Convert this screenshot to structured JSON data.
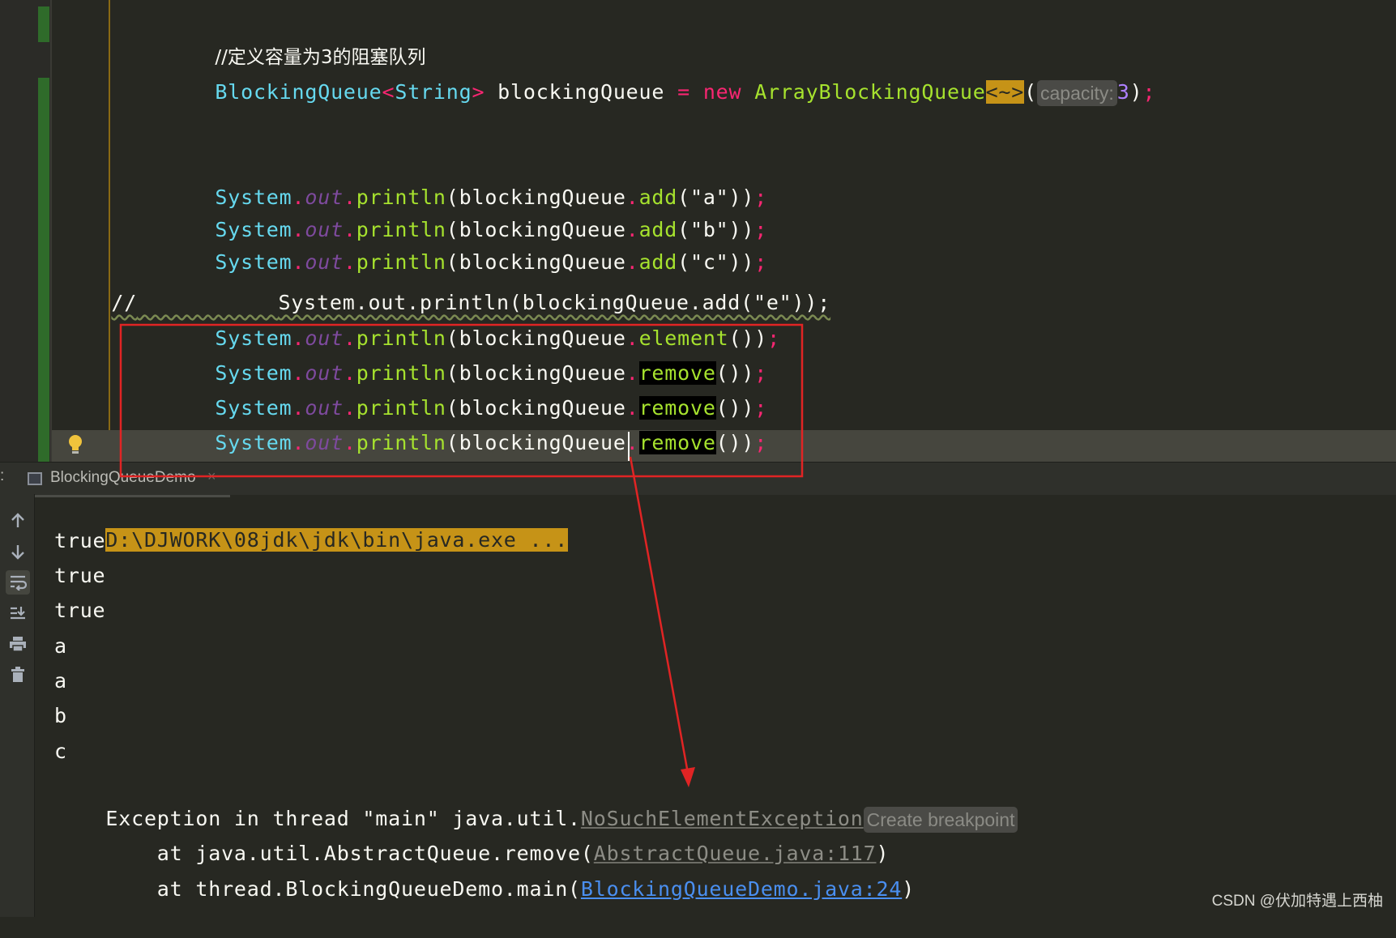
{
  "editor": {
    "lines": {
      "comment": "//定义容量为3的阻塞队列",
      "decl_type": "BlockingQueue",
      "decl_lt": "<",
      "decl_generic": "String",
      "decl_gt": ">",
      "decl_var": "blockingQueue",
      "decl_eq": "=",
      "decl_new": "new",
      "decl_class": "ArrayBlockingQueue",
      "decl_diamond": "<~>",
      "decl_open": "(",
      "decl_hint": "capacity:",
      "decl_arg": "3",
      "decl_close": ")",
      "decl_semi": ";",
      "system": "System",
      "dot": ".",
      "out": "out",
      "println": "println",
      "open_paren": "(",
      "queue": "blockingQueue",
      "add": "add",
      "arg_a": "(\"a\"))",
      "arg_b": "(\"b\"))",
      "arg_c": "(\"c\"))",
      "semi": ";",
      "commented_prefix": "//",
      "commented_code": "System.out.println(blockingQueue.add(\"e\"));",
      "element": "element",
      "remove": "remove",
      "call_close": "())"
    }
  },
  "run_panel": {
    "tab_prefix": ":",
    "tab_label": "BlockingQueueDemo",
    "tab_close": "×",
    "toolbar": [
      "up-arrow-icon",
      "down-arrow-icon",
      "soft-wrap-icon",
      "scroll-to-end-icon",
      "print-icon",
      "trash-icon"
    ],
    "console": {
      "command": "D:\\DJWORK\\08jdk\\jdk\\bin\\java.exe ...",
      "outputs": [
        "true",
        "true",
        "true",
        "a",
        "a",
        "b",
        "c"
      ],
      "exception_prefix": "Exception in thread \"main\" java.util.",
      "exception_name": "NoSuchElementException",
      "exception_hint": "Create breakpoint",
      "trace1_prefix": "    at java.util.AbstractQueue.remove(",
      "trace1_link": "AbstractQueue.java:117",
      "trace1_suffix": ")",
      "trace2_prefix": "    at thread.BlockingQueueDemo.main(",
      "trace2_link": "BlockingQueueDemo.java:24",
      "trace2_suffix": ")"
    }
  },
  "watermark": "CSDN @伏加特遇上西柚",
  "colors": {
    "background": "#272822",
    "keyword": "#f92672",
    "type": "#66d9ef",
    "method": "#a6e22e",
    "annotation_box": "#e02424",
    "command_highlight": "#c69317"
  }
}
